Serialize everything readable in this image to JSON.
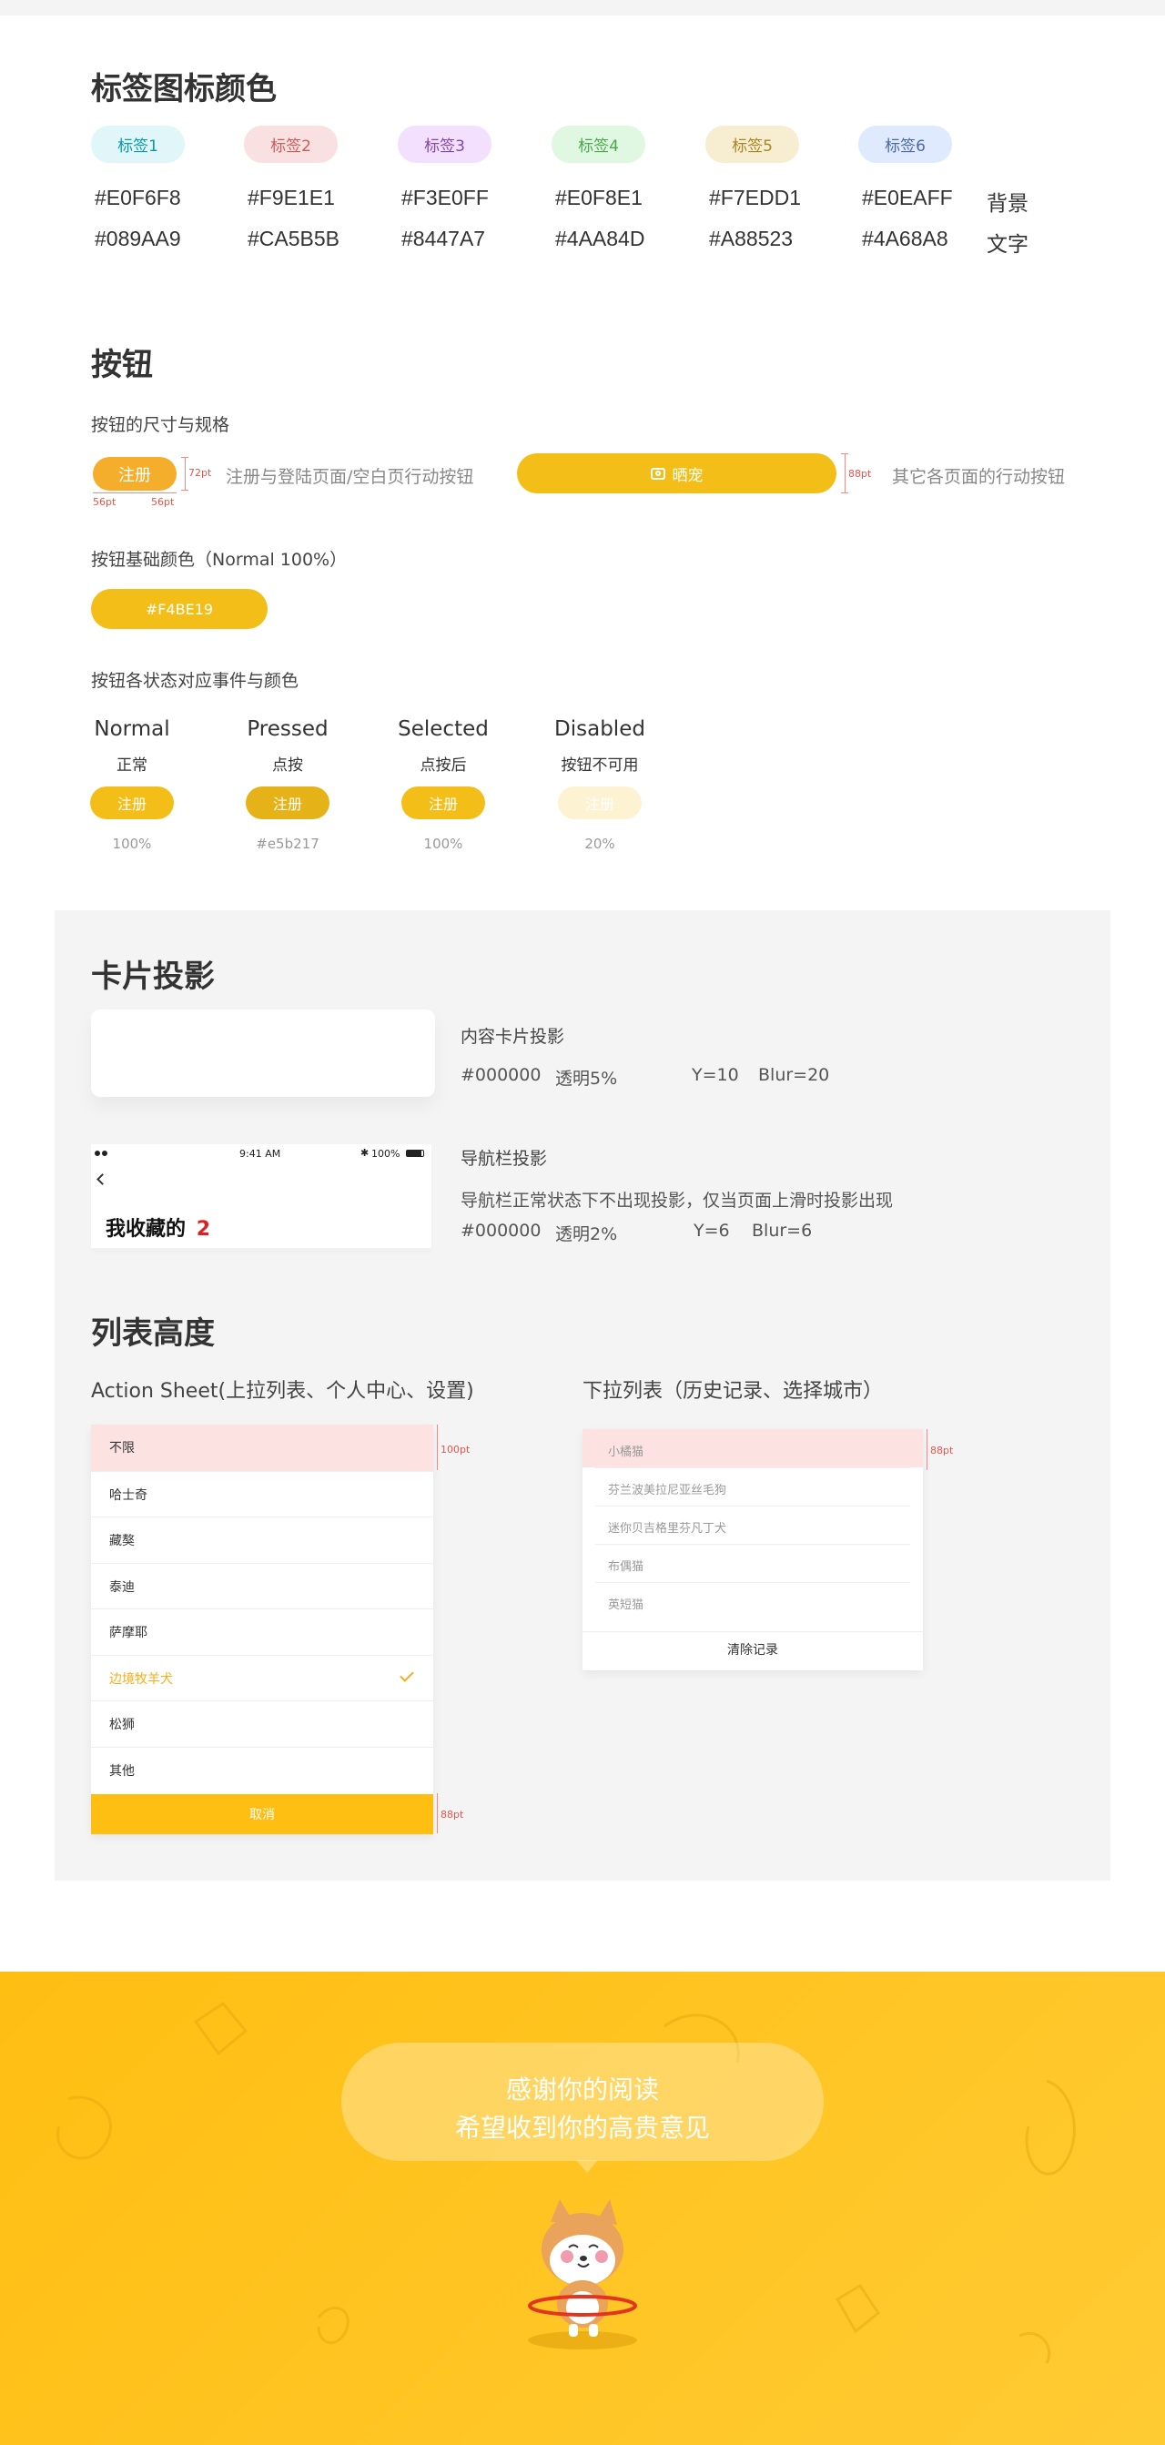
{
  "tag_section": {
    "title": "标签图标颜色",
    "tags": [
      {
        "label": "标签1",
        "bg": "#E0F6F8",
        "fg": "#089AA9",
        "bg_hex": "#E0F6F8",
        "fg_hex": "#089AA9"
      },
      {
        "label": "标签2",
        "bg": "#F9E1E1",
        "fg": "#CA5B5B",
        "bg_hex": "#F9E1E1",
        "fg_hex": "#CA5B5B"
      },
      {
        "label": "标签3",
        "bg": "#F3E0FF",
        "fg": "#8447A7",
        "bg_hex": "#F3E0FF",
        "fg_hex": "#8447A7"
      },
      {
        "label": "标签4",
        "bg": "#E0F8E1",
        "fg": "#4AA84D",
        "bg_hex": "#E0F8E1",
        "fg_hex": "#4AA84D"
      },
      {
        "label": "标签5",
        "bg": "#F7EDD1",
        "fg": "#A88523",
        "bg_hex": "#F7EDD1",
        "fg_hex": "#A88523"
      },
      {
        "label": "标签6",
        "bg": "#E0EAFF",
        "fg": "#4A68A8",
        "bg_hex": "#E0EAFF",
        "fg_hex": "#4A68A8"
      }
    ],
    "bg_label": "背景",
    "fg_label": "文字"
  },
  "button_section": {
    "title": "按钮",
    "size_heading": "按钮的尺寸与规格",
    "small_button_label": "注册",
    "small_button_height": "72pt",
    "small_button_pad_left": "56pt",
    "small_button_pad_right": "56pt",
    "small_button_desc": "注册与登陆页面/空白页行动按钮",
    "wide_button_label": "晒宠",
    "wide_button_height": "88pt",
    "wide_button_desc": "其它各页面的行动按钮",
    "base_heading": "按钮基础颜色（Normal 100%）",
    "base_button_label": "#F4BE19",
    "states_heading": "按钮各状态对应事件与颜色",
    "states": [
      {
        "en": "Normal",
        "zh": "正常",
        "label": "注册",
        "value": "100%",
        "color": "#F4BE19",
        "text": "#ffffff"
      },
      {
        "en": "Pressed",
        "zh": "点按",
        "label": "注册",
        "value": "#e5b217",
        "color": "#E5B217",
        "text": "#ffffff"
      },
      {
        "en": "Selected",
        "zh": "点按后",
        "label": "注册",
        "value": "100%",
        "color": "#F4BE19",
        "text": "#ffffff"
      },
      {
        "en": "Disabled",
        "zh": "按钮不可用",
        "label": "注册",
        "value": "20%",
        "color": "#FDF2D1",
        "text": "#ffffff"
      }
    ]
  },
  "card_section": {
    "title": "卡片投影",
    "content_card_title": "内容卡片投影",
    "content_card_spec": {
      "color": "#000000",
      "opacity": "透明5%",
      "y": "Y=10",
      "blur": "Blur=20"
    },
    "nav": {
      "status_time": "9:41 AM",
      "battery": "100%",
      "page_title": "我收藏的",
      "page_count": "2"
    },
    "nav_title": "导航栏投影",
    "nav_desc": "导航栏正常状态下不出现投影，仅当页面上滑时投影出现",
    "nav_spec": {
      "color": "#000000",
      "opacity": "透明2%",
      "y": "Y=6",
      "blur": "Blur=6"
    }
  },
  "list_section": {
    "title": "列表高度",
    "action_sheet_heading": "Action Sheet(上拉列表、个人中心、设置)",
    "action_items": [
      "不限",
      "哈士奇",
      "藏獒",
      "泰迪",
      "萨摩耶",
      "边境牧羊犬",
      "松狮",
      "其他"
    ],
    "action_selected_index": 5,
    "action_height": "100pt",
    "cancel_label": "取消",
    "cancel_height": "88pt",
    "dropdown_heading": "下拉列表（历史记录、选择城市）",
    "dropdown_items": [
      "小橘猫",
      "芬兰波美拉尼亚丝毛狗",
      "迷你贝吉格里芬凡丁犬",
      "布偶猫",
      "英短猫"
    ],
    "dropdown_height": "88pt",
    "clear_label": "清除记录"
  },
  "footer": {
    "line1": "感谢你的阅读",
    "line2": "希望收到你的高贵意见"
  },
  "colors": {
    "accent": "#F4BE19",
    "accent_dark": "#E5B217",
    "highlight_row": "#FCE3E1",
    "footer_bg": "#FFC21A",
    "panel_bg": "#F4F4F4"
  }
}
